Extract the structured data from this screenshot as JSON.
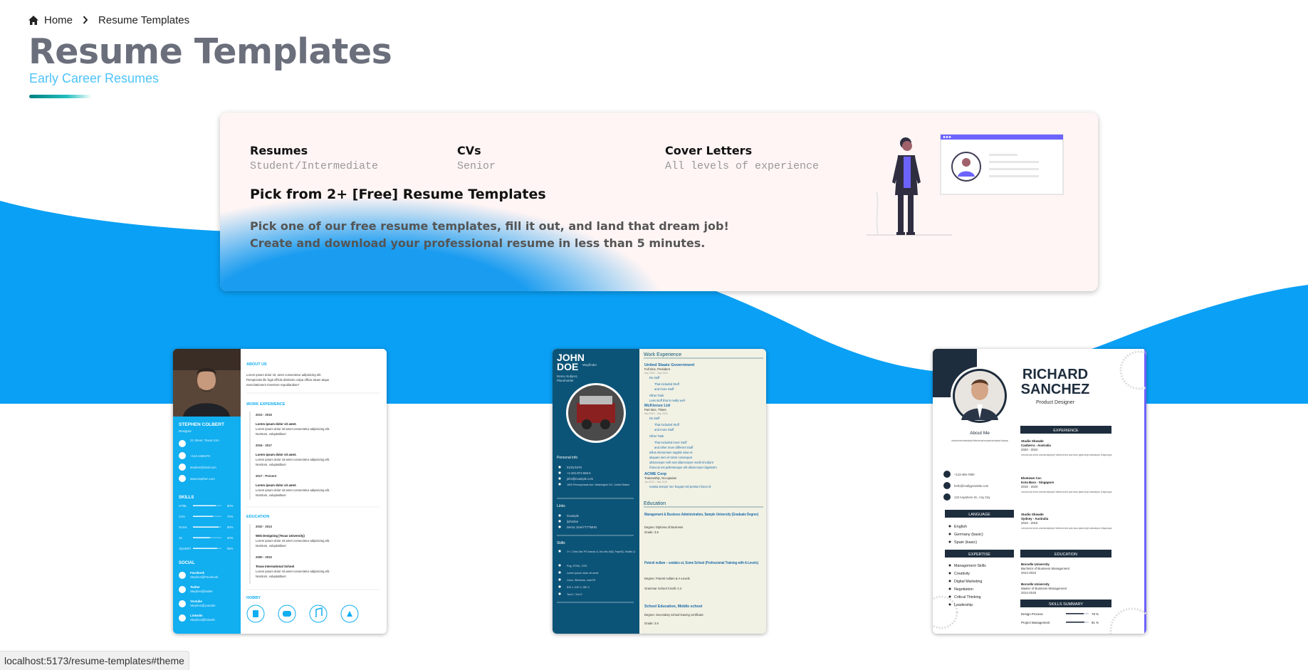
{
  "breadcrumb": {
    "home_label": "Home",
    "current_label": "Resume Templates"
  },
  "header": {
    "title": "Resume Templates",
    "subtitle": "Early Career Resumes"
  },
  "hero": {
    "categories": [
      {
        "label": "Resumes",
        "sub": "Student/Intermediate"
      },
      {
        "label": "CVs",
        "sub": "Senior"
      },
      {
        "label": "Cover Letters",
        "sub": "All levels of experience"
      }
    ],
    "heading": "Pick from 2+ [Free] Resume Templates",
    "desc_line1": "Pick one of our free resume templates, fill it out, and land that dream job!",
    "desc_line2": "Create and download your professional resume in less than 5 minutes."
  },
  "templates": [
    {
      "name": "STEPHEN COLBERT",
      "role": "Designer",
      "contacts": [
        "21 Street, Texas USA",
        "+124-4456478",
        "stephen@mail.com",
        "www.stephen.com"
      ],
      "skills_heading": "SKILLS",
      "skills": [
        {
          "name": "HTML",
          "pct": "80%",
          "level": 0.8
        },
        {
          "name": "CSS",
          "pct": "70%",
          "level": 0.7
        },
        {
          "name": "SASS",
          "pct": "90%",
          "level": 0.9
        },
        {
          "name": "JS",
          "pct": "60%",
          "level": 0.6
        },
        {
          "name": "JQUERY",
          "pct": "85%",
          "level": 0.85
        }
      ],
      "social_heading": "SOCIAL",
      "social": [
        {
          "name": "Facebook",
          "handle": "Stephen@Facebook"
        },
        {
          "name": "Twitter",
          "handle": "Stephen@twitter"
        },
        {
          "name": "Youtube",
          "handle": "Stephen@youtube"
        },
        {
          "name": "Linkedin",
          "handle": "Stephen@linkedin"
        }
      ],
      "about_heading": "ABOUT US",
      "about_line1": "Lorem ipsum dolor sit, amet consectetur adipisicing elit.",
      "about_line2": "Perspiciatis ille fugit officiis distinctio culpa officia totam atque",
      "about_line3": "exercitationem inventore repudiandae?",
      "work_heading": "WORK EXPERIENCE",
      "work": [
        {
          "years": "2013 - 2015",
          "title": "Lorem ipsum dolor sit amet.",
          "body1": "Lorem ipsum dolor sit amet consectetur adipisicing elit.",
          "body2": "Nostrum, voluptatibus!"
        },
        {
          "years": "2015 - 2017",
          "title": "Lorem ipsum dolor sit amet.",
          "body1": "Lorem ipsum dolor sit amet consectetur adipisicing elit.",
          "body2": "Nostrum, voluptatibus!"
        },
        {
          "years": "2017 - Present",
          "title": "Lorem ipsum dolor sit amet.",
          "body1": "Lorem ipsum dolor sit amet consectetur adipisicing elit.",
          "body2": "Nostrum, voluptatibus!"
        }
      ],
      "edu_heading": "EDUCATION",
      "education": [
        {
          "years": "2010 - 2013",
          "title": "Web Designing (Texas University)",
          "body1": "Lorem ipsum dolor sit amet consectetur adipisicing elit.",
          "body2": "Nostrum, voluptatibus!"
        },
        {
          "years": "2000 - 2010",
          "title": "Texas International School",
          "body1": "Lorem ipsum dolor sit amet consectetur adipisicing elit.",
          "body2": "Nostrum, voluptatibus!"
        }
      ],
      "hobby_heading": "HOBBY"
    },
    {
      "first": "JOHN",
      "last": "DOE",
      "role": "Wayfinder",
      "tagline1": "Demo Subject,",
      "tagline2": "Placeholder",
      "info_heading": "Personal info",
      "info": [
        "01/01/1970",
        "+1-201-871-555-6",
        "john@example.com",
        "1600 Pennsylvania Ave, Washington DC, United States"
      ],
      "links_heading": "Links",
      "links": [
        "/example",
        "/johndoe",
        "Demo: Doe/YT7TMHD"
      ],
      "skills_heading": "Skills",
      "skills": [
        "C++, C, Python, Bash, PHP, Javascript, C#, Java, Kotlin, MySQL, PostgreSQL, VirtualBox, Qt",
        "Pug, HTML, CSS",
        "Lorem ipsum dolor sit amet",
        "Linux, Windows, macOS",
        "IDE 1, IDE 2, IDE 3",
        "Tool 1, Tool 2"
      ],
      "work_heading": "Work Experience",
      "jobs": [
        {
          "org": "United Staats Government",
          "role": "Full time, President",
          "date": "Sep 2020 – Sep 2024",
          "items": [
            "Do stuff",
            "That included Stuff",
            "and more Stuff",
            "Other Task",
            "Less stuff that is really well"
          ]
        },
        {
          "org": "McKienze Ltd",
          "role": "Part time, Thiere",
          "date": "Mar 2019 – Sep 2020",
          "items": [
            "Do stuff",
            "That included Stuff",
            "and more Stuff",
            "Other Task",
            "That included more Stuff",
            "and other more different Stuff",
            "tellus elementum sagittis vitae et",
            "aliquam sem et tortor consequat",
            "ullamcorper velit sed ullamcorper morbi tincidunt",
            "rhoncus est pellentesque elit ullamcorper dignissim"
          ]
        },
        {
          "org": "ACME Corp",
          "role": "Traineeship, Occupation",
          "date": "Jan 2019 – Mar 2019",
          "items": [
            "massa tempor nec feugiat nisl pretium fusce id"
          ]
        }
      ],
      "edu_heading": "Education",
      "schools": [
        {
          "title": "Management & Business Administration, Sample University (Graduate Degree)",
          "detail": "Degree: Diploma of Business",
          "grade": "Grade: 3.6"
        },
        {
          "title": "Potenti nullam – sodales ut, Some School (Professional Training with A-Levels)",
          "detail": "Degree: Potenti nullam & A-Levels",
          "grade": "Grammar School Credit: 2.4"
        },
        {
          "title": "School Education, Middle school",
          "detail": "Degree: Secondary school leaving certificate",
          "grade": "Grade: 2.6"
        }
      ]
    },
    {
      "first": "RICHARD",
      "last": "SANCHEZ",
      "role": "Product Designer",
      "about_heading": "About Me",
      "about_text": "Lorem ipsum dolor sit amet, consectetur adipiscing elit. Vestibulum sit amet, quam rhoncus, egestas dui eget, malesuada justo. Ut aliquam augue.",
      "contacts": [
        "+123-456-7890",
        "hello@reallygreatsite.com",
        "123 Anywhere St., Any City"
      ],
      "language_heading": "LANGUAGE",
      "languages": [
        "English",
        "Germany (basic)",
        "Spain (basic)"
      ],
      "expertise_heading": "EXPERTISE",
      "expertise": [
        "Management Skills",
        "Creativity",
        "Digital Marketing",
        "Negotiation",
        "Critical Thinking",
        "Leadership"
      ],
      "experience_heading": "EXPERIENCE",
      "experience": [
        {
          "org": "Studio Showde",
          "place": "Canberra - Australia",
          "years": "2020 - 2022"
        },
        {
          "org": "Elsetown Cor.",
          "place": "Kota Baru - Singapore",
          "years": "2016 - 2020"
        },
        {
          "org": "Studio Showde",
          "place": "Sydney - Australia",
          "years": "2010 - 2015"
        }
      ],
      "exp_body": "Lorem ipsum dolor sit amet, consectetur adipiscing elit. Vestibulum sit amet, quam rhoncus, egestas dui eget, malesuada justo. Ut aliquam augue.",
      "education_heading": "EDUCATION",
      "education": [
        {
          "school": "Borcelle University",
          "degree": "Bachelor of Business Management",
          "years": "2014-2023"
        },
        {
          "school": "Borcelle University",
          "degree": "Master of Business Management",
          "years": "2014-2018"
        }
      ],
      "skills_heading": "SKILLS SUMMARY",
      "skills": [
        {
          "name": "Design Process",
          "pct": "78 %",
          "level": 0.78
        },
        {
          "name": "Project Management",
          "pct": "81 %",
          "level": 0.81
        }
      ]
    }
  ],
  "status_url": "localhost:5173/resume-templates#theme",
  "colors": {
    "wave_blue": "#0aa0f5",
    "title_gray": "#6b6f7c",
    "subtitle_cyan": "#4fc3f7",
    "accent_purple": "#6c63ff",
    "colbert_sidebar": "#11aef0",
    "doe_sidebar": "#0c5477",
    "doe_main": "#f1f1e4",
    "sanchez_navy": "#1e2d3d"
  }
}
